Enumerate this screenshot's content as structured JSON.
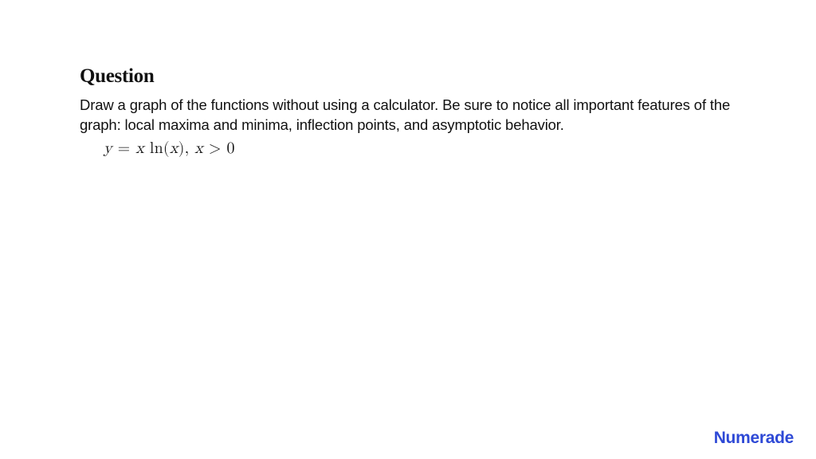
{
  "question": {
    "heading": "Question",
    "prompt": "Draw a graph of the functions without using a calculator. Be sure to notice all important features of the graph: local maxima and minima, inflection points, and asymptotic behavior.",
    "formula_parts": {
      "y": "y",
      "eq": " = ",
      "x1": "x",
      "sp1": " ",
      "ln": "ln",
      "open": "(",
      "x2": "x",
      "close": ")",
      "comma": ", ",
      "x3": "x",
      "gt": " > ",
      "zero": "0"
    }
  },
  "brand": {
    "name": "Numerade"
  }
}
